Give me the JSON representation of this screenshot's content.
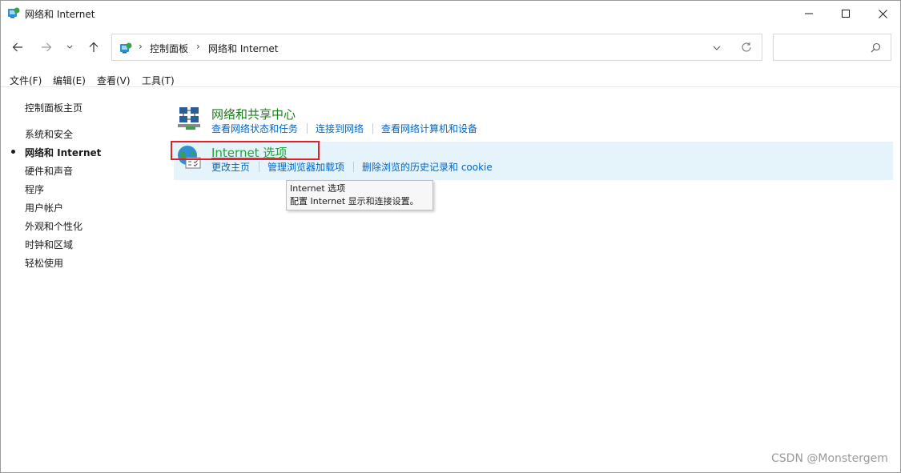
{
  "window": {
    "title": "网络和 Internet"
  },
  "nav": {
    "breadcrumbs": [
      "控制面板",
      "网络和 Internet"
    ],
    "search_placeholder": ""
  },
  "menu": [
    "文件(F)",
    "编辑(E)",
    "查看(V)",
    "工具(T)"
  ],
  "sidebar": {
    "items": [
      {
        "label": "控制面板主页",
        "current": false
      },
      {
        "label": "系统和安全",
        "current": false
      },
      {
        "label": "网络和 Internet",
        "current": true
      },
      {
        "label": "硬件和声音",
        "current": false
      },
      {
        "label": "程序",
        "current": false
      },
      {
        "label": "用户帐户",
        "current": false
      },
      {
        "label": "外观和个性化",
        "current": false
      },
      {
        "label": "时钟和区域",
        "current": false
      },
      {
        "label": "轻松使用",
        "current": false
      }
    ]
  },
  "categories": [
    {
      "title": "网络和共享中心",
      "icon": "network-sharing-center-icon",
      "tasks": [
        "查看网络状态和任务",
        "连接到网络",
        "查看网络计算机和设备"
      ]
    },
    {
      "title": "Internet 选项",
      "icon": "internet-options-icon",
      "tasks": [
        "更改主页",
        "管理浏览器加载项",
        "删除浏览的历史记录和 cookie"
      ]
    }
  ],
  "tooltip": {
    "title": "Internet 选项",
    "description": "配置 Internet 显示和连接设置。"
  },
  "watermark": "CSDN @Monstergem",
  "colors": {
    "category_title": "#1e7b1e",
    "task_link": "#0066cc",
    "highlight_bg": "#e5f3fb",
    "annotation_box": "#e0202a"
  }
}
